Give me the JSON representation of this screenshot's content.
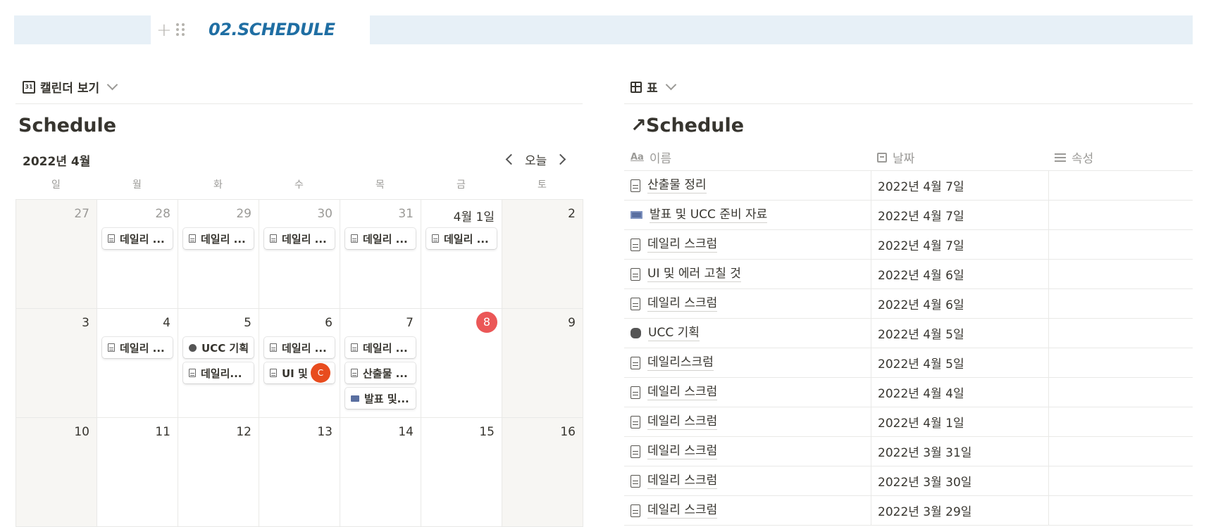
{
  "page": {
    "title": "02.SCHEDULE",
    "title_color": "#1f6ea3",
    "band_color": "#e7f0f7"
  },
  "calendar_view": {
    "tab_label": "캘린더 보기",
    "db_title": "Schedule",
    "month_label": "2022년 4월",
    "today_label": "오늘",
    "weekdays": [
      "일",
      "월",
      "화",
      "수",
      "목",
      "금",
      "토"
    ],
    "weeks": [
      [
        {
          "day": "27",
          "dim": true,
          "weekend": true,
          "events": []
        },
        {
          "day": "28",
          "dim": true,
          "events": [
            {
              "icon": "doc",
              "label": "데일리 ..."
            }
          ]
        },
        {
          "day": "29",
          "dim": true,
          "events": [
            {
              "icon": "doc",
              "label": "데일리 ..."
            }
          ]
        },
        {
          "day": "30",
          "dim": true,
          "events": [
            {
              "icon": "doc",
              "label": "데일리 ..."
            }
          ]
        },
        {
          "day": "31",
          "dim": true,
          "events": [
            {
              "icon": "doc",
              "label": "데일리 ..."
            }
          ]
        },
        {
          "day": "4월 1일",
          "events": [
            {
              "icon": "doc",
              "label": "데일리 ..."
            }
          ]
        },
        {
          "day": "2",
          "weekend": true,
          "events": []
        }
      ],
      [
        {
          "day": "3",
          "weekend": true,
          "events": []
        },
        {
          "day": "4",
          "events": [
            {
              "icon": "doc",
              "label": "데일리 ..."
            }
          ]
        },
        {
          "day": "5",
          "events": [
            {
              "icon": "camera",
              "label": "UCC 기획"
            },
            {
              "icon": "doc",
              "label": "데일리..."
            }
          ]
        },
        {
          "day": "6",
          "events": [
            {
              "icon": "doc",
              "label": "데일리 ..."
            },
            {
              "icon": "doc",
              "label": "UI 및 ...",
              "avatar": "C"
            }
          ]
        },
        {
          "day": "7",
          "events": [
            {
              "icon": "doc",
              "label": "데일리 ..."
            },
            {
              "icon": "doc",
              "label": "산출물 ..."
            },
            {
              "icon": "film",
              "label": "발표 및..."
            }
          ]
        },
        {
          "day": "8",
          "today": true,
          "events": []
        },
        {
          "day": "9",
          "weekend": true,
          "events": []
        }
      ],
      [
        {
          "day": "10",
          "weekend": true,
          "events": []
        },
        {
          "day": "11",
          "events": []
        },
        {
          "day": "12",
          "events": []
        },
        {
          "day": "13",
          "events": []
        },
        {
          "day": "14",
          "events": []
        },
        {
          "day": "15",
          "events": []
        },
        {
          "day": "16",
          "weekend": true,
          "events": []
        }
      ]
    ]
  },
  "table_view": {
    "tab_label": "표",
    "db_title": "Schedule",
    "columns": [
      "이름",
      "날짜",
      "속성"
    ],
    "rows": [
      {
        "icon": "doc",
        "name": "산출물 정리",
        "date": "2022년 4월 7일",
        "prop": ""
      },
      {
        "icon": "film",
        "name": "발표 및 UCC 준비 자료",
        "date": "2022년 4월 7일",
        "prop": ""
      },
      {
        "icon": "doc",
        "name": "데일리 스크럼",
        "date": "2022년 4월 7일",
        "prop": ""
      },
      {
        "icon": "doc",
        "name": "UI 및 에러 고칠 것",
        "date": "2022년 4월 6일",
        "prop": ""
      },
      {
        "icon": "doc",
        "name": "데일리 스크럼",
        "date": "2022년 4월 6일",
        "prop": ""
      },
      {
        "icon": "camera",
        "name": "UCC 기획",
        "date": "2022년 4월 5일",
        "prop": ""
      },
      {
        "icon": "doc",
        "name": "데일리스크럼",
        "date": "2022년 4월 5일",
        "prop": ""
      },
      {
        "icon": "doc",
        "name": "데일리 스크럼",
        "date": "2022년 4월 4일",
        "prop": ""
      },
      {
        "icon": "doc",
        "name": "데일리 스크럼",
        "date": "2022년 4월 1일",
        "prop": ""
      },
      {
        "icon": "doc",
        "name": "데일리 스크럼",
        "date": "2022년 3월 31일",
        "prop": ""
      },
      {
        "icon": "doc",
        "name": "데일리 스크럼",
        "date": "2022년 3월 30일",
        "prop": ""
      },
      {
        "icon": "doc",
        "name": "데일리 스크럼",
        "date": "2022년 3월 29일",
        "prop": ""
      }
    ]
  }
}
